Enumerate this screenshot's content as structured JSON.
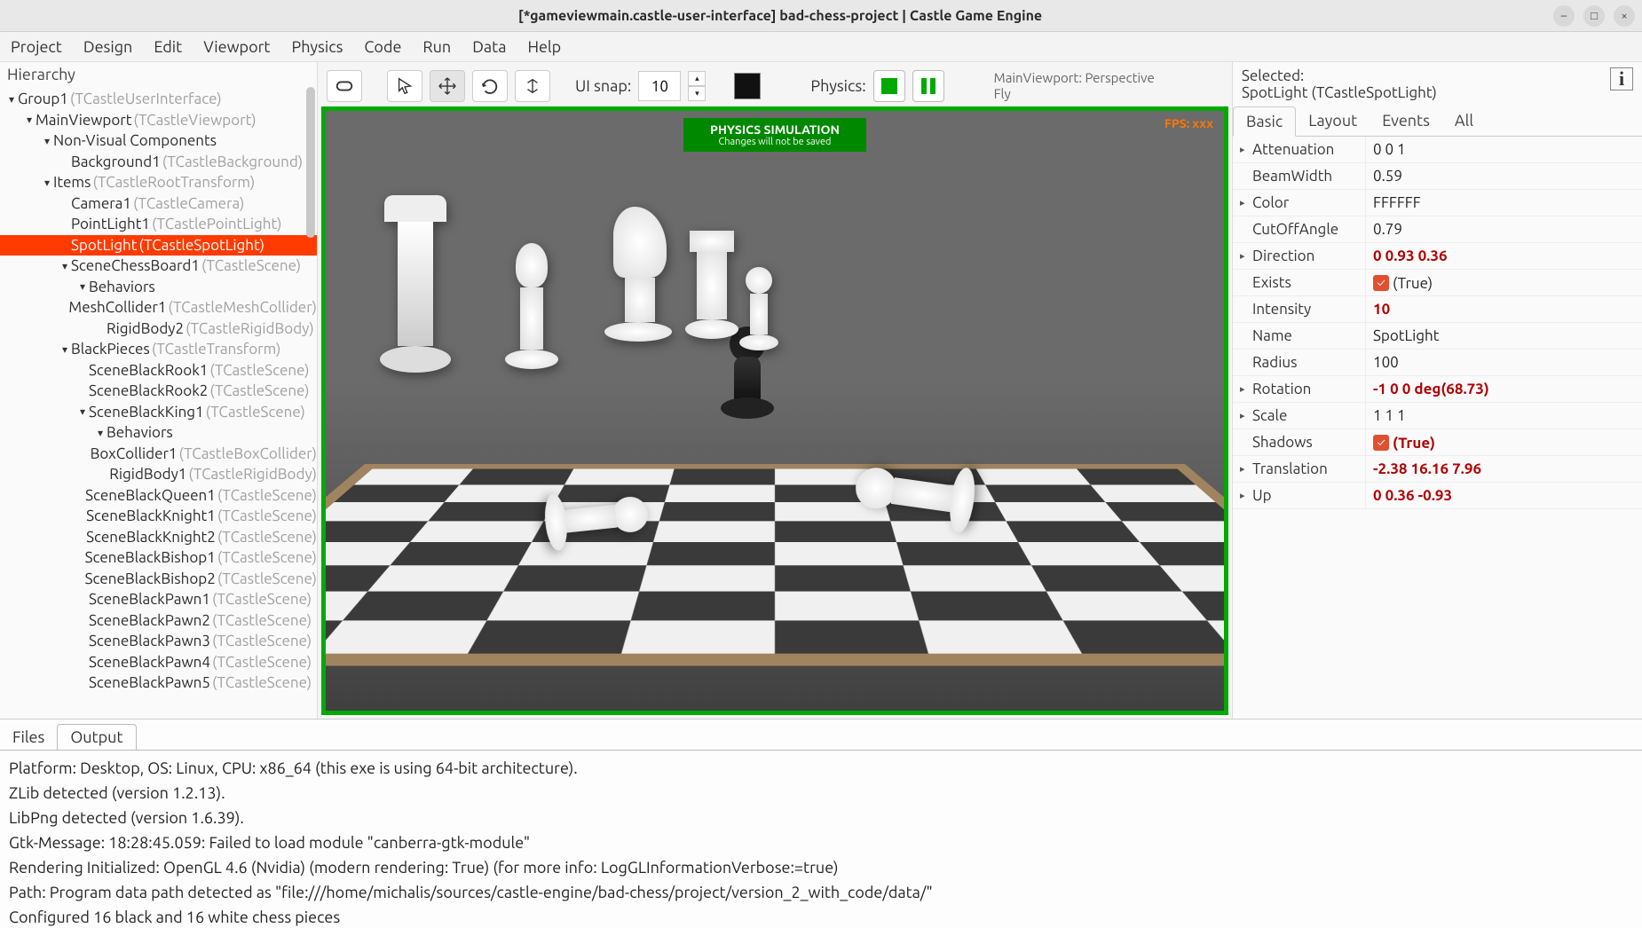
{
  "window": {
    "title": "[*gameviewmain.castle-user-interface] bad-chess-project | Castle Game Engine"
  },
  "menu": [
    "Project",
    "Design",
    "Edit",
    "Viewport",
    "Physics",
    "Code",
    "Run",
    "Data",
    "Help"
  ],
  "hierarchy_label": "Hierarchy",
  "tree": [
    {
      "d": 0,
      "c": "▾",
      "n": "Group1",
      "t": "(TCastleUserInterface)"
    },
    {
      "d": 1,
      "c": "▾",
      "n": "MainViewport",
      "t": "(TCastleViewport)"
    },
    {
      "d": 2,
      "c": "▾",
      "n": "Non-Visual Components",
      "t": ""
    },
    {
      "d": 3,
      "c": "",
      "n": "Background1",
      "t": "(TCastleBackground)"
    },
    {
      "d": 2,
      "c": "▾",
      "n": "Items",
      "t": "(TCastleRootTransform)"
    },
    {
      "d": 3,
      "c": "",
      "n": "Camera1",
      "t": "(TCastleCamera)"
    },
    {
      "d": 3,
      "c": "",
      "n": "PointLight1",
      "t": "(TCastlePointLight)"
    },
    {
      "d": 3,
      "c": "",
      "n": "SpotLight",
      "t": "(TCastleSpotLight)",
      "sel": true
    },
    {
      "d": 3,
      "c": "▾",
      "n": "SceneChessBoard1",
      "t": "(TCastleScene)"
    },
    {
      "d": 4,
      "c": "▾",
      "n": "Behaviors",
      "t": ""
    },
    {
      "d": 5,
      "c": "",
      "n": "MeshCollider1",
      "t": "(TCastleMeshCollider)"
    },
    {
      "d": 5,
      "c": "",
      "n": "RigidBody2",
      "t": "(TCastleRigidBody)"
    },
    {
      "d": 3,
      "c": "▾",
      "n": "BlackPieces",
      "t": "(TCastleTransform)"
    },
    {
      "d": 4,
      "c": "",
      "n": "SceneBlackRook1",
      "t": "(TCastleScene)"
    },
    {
      "d": 4,
      "c": "",
      "n": "SceneBlackRook2",
      "t": "(TCastleScene)"
    },
    {
      "d": 4,
      "c": "▾",
      "n": "SceneBlackKing1",
      "t": "(TCastleScene)"
    },
    {
      "d": 5,
      "c": "▾",
      "n": "Behaviors",
      "t": ""
    },
    {
      "d": 6,
      "c": "",
      "n": "BoxCollider1",
      "t": "(TCastleBoxCollider)"
    },
    {
      "d": 6,
      "c": "",
      "n": "RigidBody1",
      "t": "(TCastleRigidBody)"
    },
    {
      "d": 4,
      "c": "",
      "n": "SceneBlackQueen1",
      "t": "(TCastleScene)"
    },
    {
      "d": 4,
      "c": "",
      "n": "SceneBlackKnight1",
      "t": "(TCastleScene)"
    },
    {
      "d": 4,
      "c": "",
      "n": "SceneBlackKnight2",
      "t": "(TCastleScene)"
    },
    {
      "d": 4,
      "c": "",
      "n": "SceneBlackBishop1",
      "t": "(TCastleScene)"
    },
    {
      "d": 4,
      "c": "",
      "n": "SceneBlackBishop2",
      "t": "(TCastleScene)"
    },
    {
      "d": 4,
      "c": "",
      "n": "SceneBlackPawn1",
      "t": "(TCastleScene)"
    },
    {
      "d": 4,
      "c": "",
      "n": "SceneBlackPawn2",
      "t": "(TCastleScene)"
    },
    {
      "d": 4,
      "c": "",
      "n": "SceneBlackPawn3",
      "t": "(TCastleScene)"
    },
    {
      "d": 4,
      "c": "",
      "n": "SceneBlackPawn4",
      "t": "(TCastleScene)"
    },
    {
      "d": 4,
      "c": "",
      "n": "SceneBlackPawn5",
      "t": "(TCastleScene)"
    }
  ],
  "toolbar": {
    "ui_snap_label": "UI snap:",
    "ui_snap_value": "10",
    "physics_label": "Physics:",
    "nav_line1": "MainViewport: Perspective",
    "nav_line2": "Fly"
  },
  "viewport": {
    "sim_title": "PHYSICS SIMULATION",
    "sim_sub": "Changes will not be saved",
    "fps": "FPS: xxx"
  },
  "inspector": {
    "selected_label": "Selected:",
    "selected_value": "SpotLight (TCastleSpotLight)",
    "tabs": [
      "Basic",
      "Layout",
      "Events",
      "All"
    ],
    "props": [
      {
        "exp": "▸",
        "name": "Attenuation",
        "value": "0 0 1",
        "bold": false
      },
      {
        "exp": "",
        "name": "BeamWidth",
        "value": "0.59",
        "bold": false
      },
      {
        "exp": "▸",
        "name": "Color",
        "value": "FFFFFF",
        "bold": false
      },
      {
        "exp": "",
        "name": "CutOffAngle",
        "value": "0.79",
        "bold": false
      },
      {
        "exp": "▸",
        "name": "Direction",
        "value": "0 0.93 0.36",
        "bold": true
      },
      {
        "exp": "",
        "name": "Exists",
        "value": "(True)",
        "bold": false,
        "check": true
      },
      {
        "exp": "",
        "name": "Intensity",
        "value": "10",
        "bold": true
      },
      {
        "exp": "",
        "name": "Name",
        "value": "SpotLight",
        "bold": false
      },
      {
        "exp": "",
        "name": "Radius",
        "value": "100",
        "bold": false
      },
      {
        "exp": "▸",
        "name": "Rotation",
        "value": "-1 0 0 deg(68.73)",
        "bold": true
      },
      {
        "exp": "▸",
        "name": "Scale",
        "value": "1 1 1",
        "bold": false
      },
      {
        "exp": "",
        "name": "Shadows",
        "value": "(True)",
        "bold": true,
        "check": true
      },
      {
        "exp": "▸",
        "name": "Translation",
        "value": "-2.38 16.16 7.96",
        "bold": true
      },
      {
        "exp": "▸",
        "name": "Up",
        "value": "0 0.36 -0.93",
        "bold": true
      }
    ]
  },
  "bottom": {
    "tabs": [
      "Files",
      "Output"
    ],
    "lines": [
      " Platform: Desktop, OS: Linux, CPU: x86_64 (this exe is using 64-bit architecture).",
      "ZLib detected (version 1.2.13).",
      "LibPng detected (version 1.6.39).",
      "Gtk-Message: 18:28:45.059: Failed to load module \"canberra-gtk-module\"",
      "Rendering Initialized: OpenGL 4.6 (Nvidia) (modern rendering: True) (for more info: LogGLInformationVerbose:=true)",
      "Path: Program data path detected as \"file:///home/michalis/sources/castle-engine/bad-chess/project/version_2_with_code/data/\"",
      "Configured 16 black and 16 white chess pieces"
    ]
  }
}
